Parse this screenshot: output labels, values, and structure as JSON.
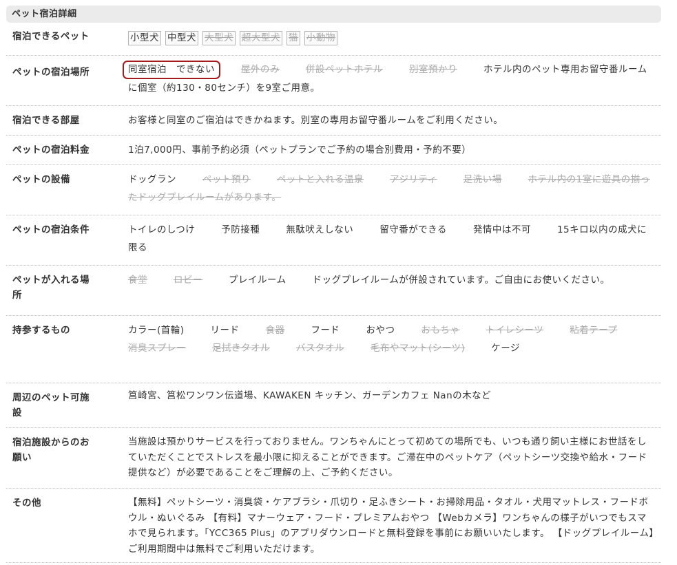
{
  "section": {
    "title": "ペット宿泊詳細"
  },
  "rows": {
    "pets": {
      "label": "宿泊できるペット",
      "chips": [
        {
          "text": "小型犬",
          "active": true
        },
        {
          "text": "中型犬",
          "active": true
        },
        {
          "text": "大型犬",
          "active": false
        },
        {
          "text": "超大型犬",
          "active": false
        },
        {
          "text": "猫",
          "active": false
        },
        {
          "text": "小動物",
          "active": false
        }
      ]
    },
    "location": {
      "label": "ペットの宿泊場所",
      "options": [
        {
          "text": "同室宿泊　できない",
          "highlight": true
        },
        {
          "text": "屋外のみ",
          "active": false
        },
        {
          "text": "併設ペットホテル",
          "active": false
        },
        {
          "text": "別室預かり",
          "active": false
        }
      ],
      "note": "ホテル内のペット専用お留守番ルームに個室（約130・80センチ）を9室ご用意。"
    },
    "room": {
      "label": "宿泊できる部屋",
      "text": "お客様と同室のご宿泊はできかねます。別室の専用お留守番ルームをご利用ください。"
    },
    "fee": {
      "label": "ペットの宿泊料金",
      "text": "1泊7,000円、事前予約必須（ペットプランでご予約の場合別費用・予約不要）"
    },
    "facilities": {
      "label": "ペットの設備",
      "items": [
        {
          "text": "ドッグラン",
          "active": true
        },
        {
          "text": "ペット預り",
          "active": false
        },
        {
          "text": "ペットと入れる温泉",
          "active": false
        },
        {
          "text": "アジリティ",
          "active": false
        },
        {
          "text": "足洗い場",
          "active": false
        },
        {
          "text": "ホテル内の1室に遊具の揃ったドッグプレイルームがあります。",
          "active": false
        }
      ]
    },
    "conditions": {
      "label": "ペットの宿泊条件",
      "items": [
        "トイレのしつけ",
        "予防接種",
        "無駄吠えしない",
        "留守番ができる",
        "発情中は不可",
        "15キロ以内の成犬に限る"
      ]
    },
    "areas": {
      "label_line1": "ペットが入れる場",
      "label_line2": "所",
      "items": [
        {
          "text": "食堂",
          "active": false
        },
        {
          "text": "ロビー",
          "active": false
        },
        {
          "text": "プレイルーム",
          "active": true
        },
        {
          "text": "ドッグプレイルームが併設されています。ご自由にお使いください。",
          "active": true
        }
      ]
    },
    "bring": {
      "label": "持参するもの",
      "items": [
        {
          "text": "カラー(首輪)",
          "active": true
        },
        {
          "text": "リード",
          "active": true
        },
        {
          "text": "食器",
          "active": false
        },
        {
          "text": "フード",
          "active": true
        },
        {
          "text": "おやつ",
          "active": true
        },
        {
          "text": "おもちゃ",
          "active": false
        },
        {
          "text": "トイレシーツ",
          "active": false
        },
        {
          "text": "粘着テープ",
          "active": false
        },
        {
          "text": "消臭スプレー",
          "active": false
        },
        {
          "text": "足拭きタオル",
          "active": false
        },
        {
          "text": "バスタオル",
          "active": false
        },
        {
          "text": "毛布やマット(シーツ)",
          "active": false
        },
        {
          "text": "ケージ",
          "active": true
        }
      ]
    },
    "nearby": {
      "label_line1": "周辺のペット可施",
      "label_line2": "設",
      "text": "筥崎宮、筥松ワンワン伝道場、KAWAKEN キッチン、ガーデンカフェ Nanの木など"
    },
    "request": {
      "label_line1": "宿泊施設からのお",
      "label_line2": "願い",
      "text": "当施設は預かりサービスを行っておりません。ワンちゃんにとって初めての場所でも、いつも通り飼い主様にお世話をしていただくことでストレスを最小限に抑えることができます。ご滞在中のペットケア（ペットシーツ交換や給水・フード提供など）が必要であることをご理解の上、ご予約ください。"
    },
    "other": {
      "label": "その他",
      "text": "【無料】ペットシーツ・消臭袋・ケアブラシ・爪切り・足ふきシート・お掃除用品・タオル・犬用マットレス・フードボウル・ぬいぐるみ 【有料】マナーウェア・フード・プレミアムおやつ 【Webカメラ】ワンちゃんの様子がいつでもスマホで見られます。「YCC365 Plus」のアプリダウンロードと無料登録を事前にお願いいたします。 【ドッグプレイルーム】ご利用期間中は無料でご利用いただけます。"
    }
  },
  "colors": {
    "highlight_border": "#a8191b",
    "inactive_text": "#aaaaaa",
    "header_bg": "#ebebeb"
  }
}
